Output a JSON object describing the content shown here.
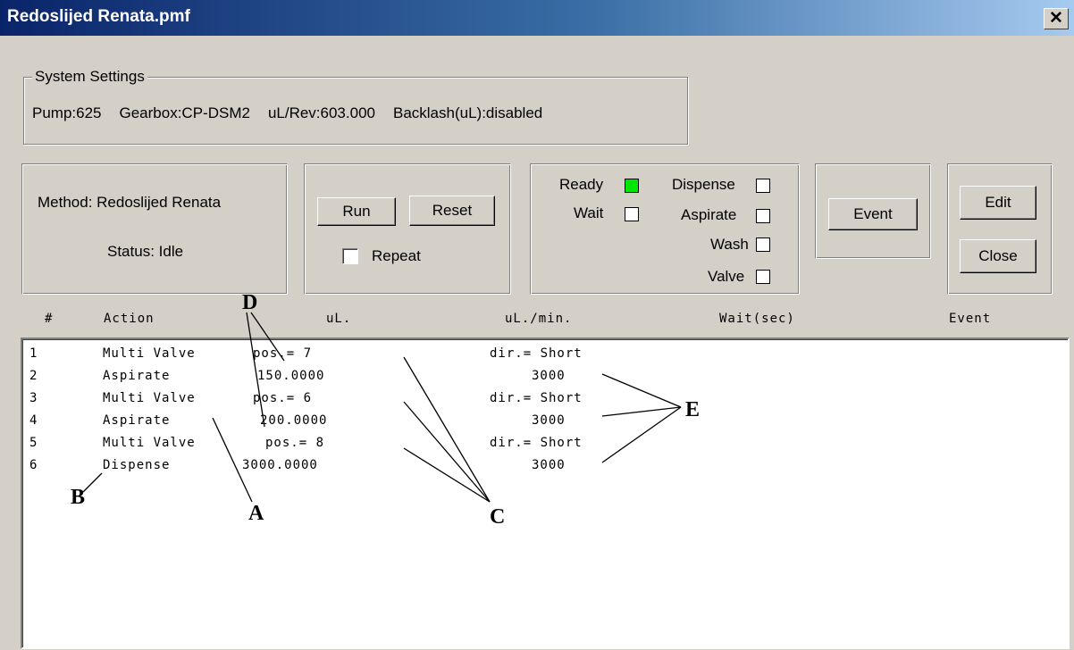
{
  "window": {
    "title": "Redoslijed Renata.pmf",
    "close_label": "✕"
  },
  "system_settings": {
    "label": "System Settings",
    "pump": "Pump:625",
    "gearbox": "Gearbox:CP-DSM2",
    "ul_rev": "uL/Rev:603.000",
    "backlash": "Backlash(uL):disabled"
  },
  "method_panel": {
    "method": "Method: Redoslijed Renata",
    "status": "Status: Idle"
  },
  "run_panel": {
    "run_label": "Run",
    "reset_label": "Reset",
    "repeat_label": "Repeat",
    "repeat_checked": false
  },
  "status_panel": {
    "ready": "Ready",
    "wait": "Wait",
    "dispense": "Dispense",
    "aspirate": "Aspirate",
    "wash": "Wash",
    "valve": "Valve",
    "ready_color": "#00e600"
  },
  "event_button": "Event",
  "edit_button": "Edit",
  "close_button": "Close",
  "table": {
    "headers": [
      "#",
      "Action",
      "uL.",
      "uL./min.",
      "Wait(sec)",
      "Event"
    ],
    "rows": [
      {
        "num": "1",
        "action": "Multi Valve",
        "ul": "pos.= 7",
        "rate": "dir.= Short"
      },
      {
        "num": "2",
        "action": "Aspirate",
        "ul": "150.0000",
        "rate": "3000"
      },
      {
        "num": "3",
        "action": "Multi Valve",
        "ul": "pos.= 6",
        "rate": "dir.= Short"
      },
      {
        "num": "4",
        "action": "Aspirate",
        "ul": "200.0000",
        "rate": "3000"
      },
      {
        "num": "5",
        "action": "Multi Valve",
        "ul": "pos.= 8",
        "rate": "dir.= Short"
      },
      {
        "num": "6",
        "action": "Dispense",
        "ul": "3000.0000",
        "rate": "3000"
      }
    ]
  },
  "annotations": {
    "a": "A",
    "b": "B",
    "c": "C",
    "d": "D",
    "e": "E"
  }
}
